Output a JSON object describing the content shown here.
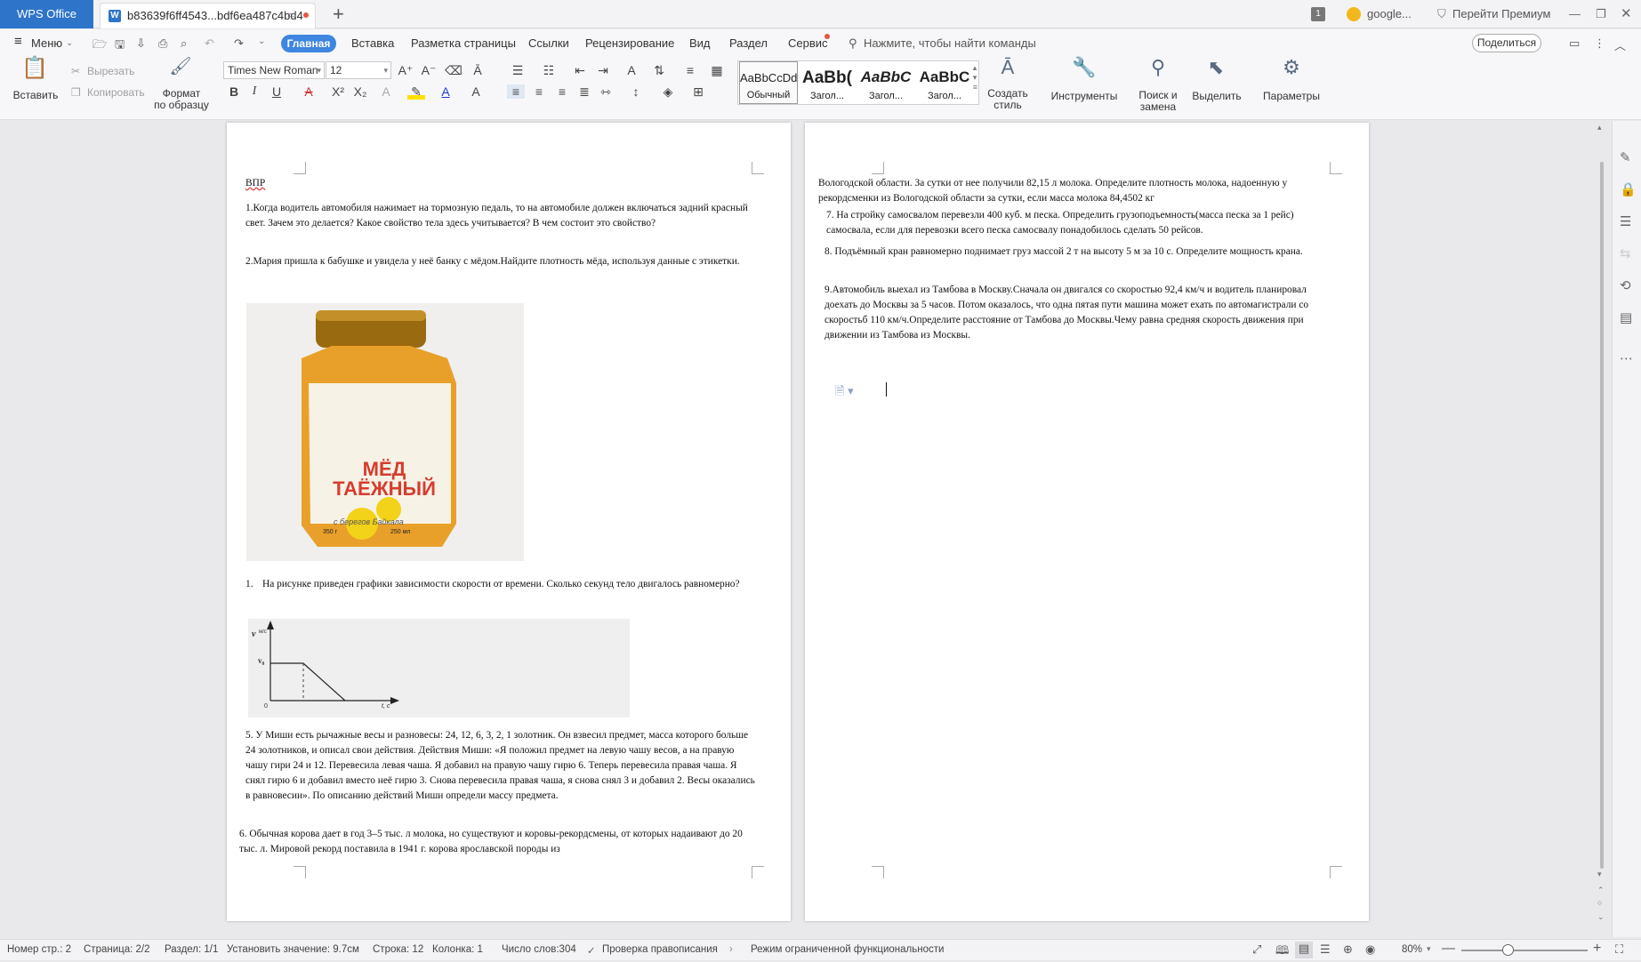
{
  "app": {
    "name": "WPS Office"
  },
  "tab": {
    "title": "b83639f6ff4543...bdf6ea487c4bd4"
  },
  "titlebar": {
    "badge": "1",
    "account": "google...",
    "premium": "Перейти Премиум"
  },
  "menu": {
    "menu_label": "Меню",
    "tabs": [
      "Главная",
      "Вставка",
      "Разметка страницы",
      "Ссылки",
      "Рецензирование",
      "Вид",
      "Раздел",
      "Сервис"
    ],
    "search_placeholder": "Нажмите, чтобы найти команды",
    "share": "Поделиться"
  },
  "ribbon": {
    "paste": "Вставить",
    "cut": "Вырезать",
    "copy": "Копировать",
    "format_painter_1": "Формат",
    "format_painter_2": "по образцу",
    "font": "Times New Roman",
    "size": "12",
    "styles": [
      {
        "preview": "AaBbCcDd",
        "name": "Обычный"
      },
      {
        "preview": "AaBb(",
        "name": "Загол..."
      },
      {
        "preview": "AaBbC",
        "name": "Загол..."
      },
      {
        "preview": "AaBbC",
        "name": "Загол..."
      }
    ],
    "create_style_1": "Создать",
    "create_style_2": "стиль",
    "tools": "Инструменты",
    "find_1": "Поиск и",
    "find_2": "замена",
    "select": "Выделить",
    "params": "Параметры"
  },
  "doc": {
    "p1_title": "ВПР",
    "q1": "1.Когда водитель автомобиля нажимает на тормозную педаль, то на автомобиле должен включаться задний красный свет. Зачем это делается? Какое свойство тела здесь учитывается? В чем состоит это свойство?",
    "q2": "2.Мария пришла к бабушке и увидела у неё банку с мёдом.Найдите плотность мёда, используя данные с этикетки.",
    "jar_label_1": "МЁД",
    "jar_label_2": "ТАЁЖНЫЙ",
    "jar_sub": "с берегов Байкала",
    "jar_mass": "350 г",
    "jar_vol": "250 мл",
    "q3": "На рисунке приведен графики зависимости скорости от времени. Сколько секунд тело двигалось равномерно?",
    "q3_num": "1.",
    "graph_v": "v",
    "graph_unit": "м/с",
    "graph_v0": "v₀",
    "graph_t": "t, с",
    "graph_zero": "0",
    "q5": "5. У Миши есть рычажные весы и разновесы: 24, 12, 6, 3, 2, 1 золотник. Он взвесил предмет, масса которого больше 24 золотников, и описал свои действия. Действия Миши: «Я положил предмет на левую чашу весов, а на правую чашу гири 24 и 12. Перевесила левая чаша. Я добавил на правую чашу гирю 6. Теперь перевесила правая чаша. Я снял гирю 6 и добавил вместо неё гирю 3. Снова перевесила правая чаша, я снова снял 3 и добавил 2. Весы оказались в равновесии». По описанию действий Миши определи массу предмета.",
    "q6": "6. Обычная корова дает в год 3–5 тыс. л молока, но существуют и коровы-рекордсмены, от которых надаивают до 20 тыс. л. Мировой рекорд поставила в 1941 г. корова ярославской породы из",
    "p2_cont": "Вологодской области. За сутки от нее получили 82,15 л молока. Определите плотность молока, надоенную у рекордсменки из Вологодской области за сутки, если масса молока 84,4502 кг",
    "q7": "7. На стройку самосвалом перевезли 400 куб. м песка. Определить грузоподъемность(масса песка за 1 рейс) самосвала, если для перевозки всего песка самосвалу понадобилось сделать 50 рейсов.",
    "q8": "8. Подъёмный кран равномерно поднимает груз массой 2 т на высоту 5 м за 10 с. Определите мощность крана.",
    "q9": "9.Автомобиль выехал из Тамбова в Москву.Сначала он двигался со скоростью 92,4 км/ч и водитель планировал доехать до Москвы за 5 часов. Потом оказалось, что одна пятая пути машина может ехать по автомагистрали со скоростьб 110 км/ч.Определите расстояние от Тамбова до Москвы.Чему равна средняя скорость движения при движении из Тамбова из Москвы."
  },
  "status": {
    "pagenum": "Номер стр.: 2",
    "page": "Страница: 2/2",
    "section": "Раздел: 1/1",
    "setval": "Установить значение: 9.7см",
    "line": "Строка: 12",
    "col": "Колонка: 1",
    "words": "Число слов:304",
    "spell": "Проверка правописания",
    "mode": "Режим ограниченной функциональности",
    "zoom": "80%"
  }
}
